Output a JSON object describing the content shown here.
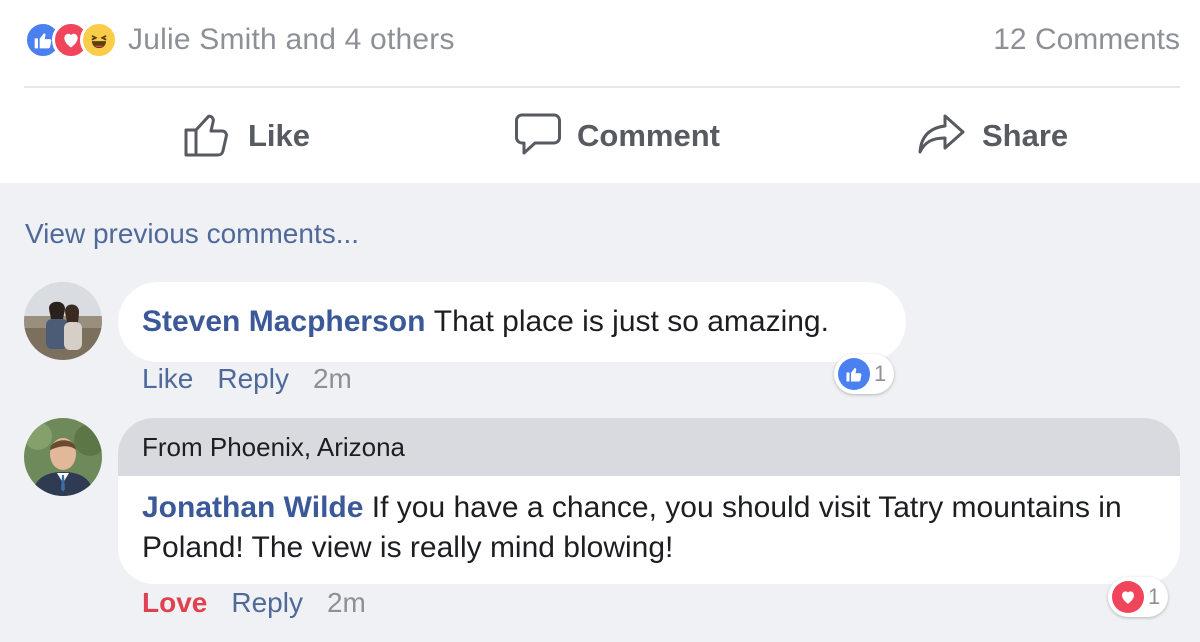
{
  "post_summary": {
    "reaction_icons": [
      "like-reaction-icon",
      "love-reaction-icon",
      "haha-reaction-icon"
    ],
    "reactors_text": "Julie Smith and 4 others",
    "comments_count": "12 Comments"
  },
  "action_bar": {
    "like_label": "Like",
    "comment_label": "Comment",
    "share_label": "Share"
  },
  "comments_section": {
    "view_previous_label": "View previous comments...",
    "comments": [
      {
        "author": "Steven Macpherson",
        "text": "That place is just so amazing.",
        "action_label": "Like",
        "reply_label": "Reply",
        "time": "2m",
        "reaction_icon": "like-reaction-icon",
        "reaction_count": "1"
      },
      {
        "location": "From Phoenix, Arizona",
        "author": "Jonathan Wilde",
        "text": "If you have a chance, you should visit Tatry mountains in Poland! The view is really mind blowing!",
        "action_label": "Love",
        "reply_label": "Reply",
        "time": "2m",
        "reaction_icon": "love-reaction-icon",
        "reaction_count": "1"
      }
    ]
  },
  "colors": {
    "link_blue": "#3b5998",
    "meta_blue": "#4f6a99",
    "love_red": "#e0404f",
    "like_blue": "#4a80f0",
    "feed_background": "#f0f1f4"
  }
}
